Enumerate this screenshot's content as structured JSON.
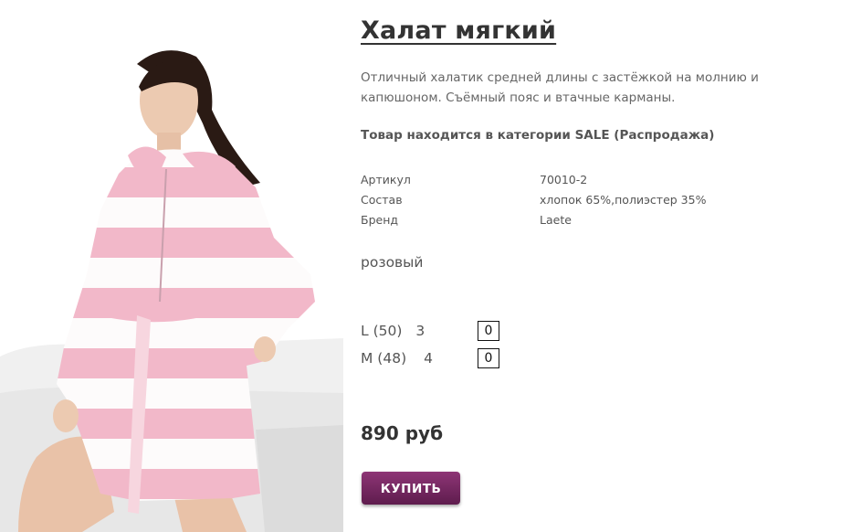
{
  "product": {
    "title": "Халат мягкий",
    "description": "Отличный халатик средней длины с застёжкой на молнию и капюшоном. Съёмный пояс и втачные карманы.",
    "category_note": "Товар находится в категории SALE (Распродажа)",
    "specs": [
      {
        "label": "Артикул",
        "value": "70010-2"
      },
      {
        "label": "Состав",
        "value": "хлопок 65%,полиэстер 35%"
      },
      {
        "label": "Бренд",
        "value": "Laete"
      }
    ],
    "color": "розовый",
    "sizes": [
      {
        "label": "L (50)",
        "stock": "3",
        "qty": "0"
      },
      {
        "label": "M (48)",
        "stock": "4",
        "qty": "0"
      }
    ],
    "price": "890 руб",
    "buy_label": "КУПИТЬ"
  },
  "colors": {
    "buy_button_top": "#8e3576",
    "buy_button_bottom": "#5e1c4d",
    "robe_pink": "#f2b8c9"
  }
}
